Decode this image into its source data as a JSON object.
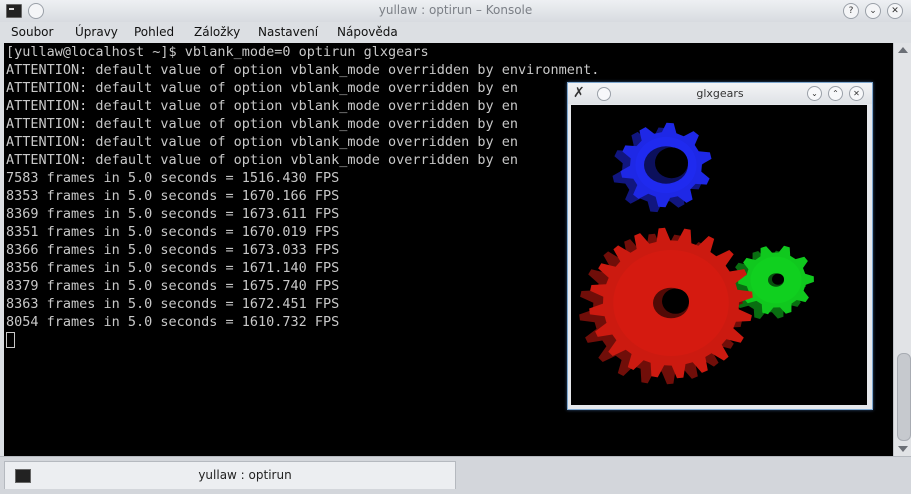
{
  "window": {
    "title": "yullaw : optirun – Konsole",
    "buttons": {
      "help": "?",
      "minimize": "⌄",
      "maximize": "⌃",
      "close": "✕"
    }
  },
  "menu": [
    "Soubor",
    "Úpravy",
    "Pohled",
    "Záložky",
    "Nastavení",
    "Nápověda"
  ],
  "terminal": {
    "lines": [
      "[yullaw@localhost ~]$ vblank_mode=0 optirun glxgears",
      "ATTENTION: default value of option vblank_mode overridden by environment.",
      "ATTENTION: default value of option vblank_mode overridden by en",
      "ATTENTION: default value of option vblank_mode overridden by en",
      "ATTENTION: default value of option vblank_mode overridden by en",
      "ATTENTION: default value of option vblank_mode overridden by en",
      "ATTENTION: default value of option vblank_mode overridden by en",
      "7583 frames in 5.0 seconds = 1516.430 FPS",
      "8353 frames in 5.0 seconds = 1670.166 FPS",
      "8369 frames in 5.0 seconds = 1673.611 FPS",
      "8351 frames in 5.0 seconds = 1670.019 FPS",
      "8366 frames in 5.0 seconds = 1673.033 FPS",
      "8356 frames in 5.0 seconds = 1671.140 FPS",
      "8379 frames in 5.0 seconds = 1675.740 FPS",
      "8363 frames in 5.0 seconds = 1672.451 FPS",
      "8054 frames in 5.0 seconds = 1610.732 FPS"
    ]
  },
  "tab": {
    "label": "yullaw : optirun"
  },
  "glxgears": {
    "title": "glxgears",
    "buttons": {
      "minimize": "⌄",
      "maximize": "⌃",
      "close": "✕"
    },
    "gear_colors": {
      "red": "#cc1a10",
      "green": "#10c81e",
      "blue": "#1e28e6"
    }
  },
  "colors": {
    "terminal_bg": "#000000",
    "terminal_fg": "#c8c8c8",
    "window_bg": "#dcdfe3"
  }
}
